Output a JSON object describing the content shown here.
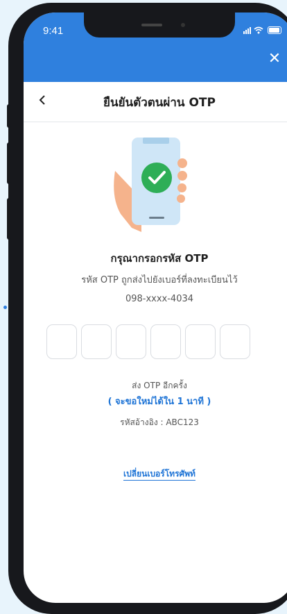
{
  "status_bar": {
    "time": "9:41"
  },
  "header": {
    "title": "ยืนยันตัวตนผ่าน OTP",
    "back_icon": "chevron-left-icon",
    "close_icon": "close-icon"
  },
  "main": {
    "prompt": "กรุณากรอกรหัส OTP",
    "description": "รหัส OTP ถูกส่งไปยังเบอร์ที่ลงทะเบียนไว้",
    "phone": "098-xxxx-4034",
    "otp_fields": [
      "",
      "",
      "",
      "",
      "",
      ""
    ],
    "resend_label": "ส่ง OTP อีกครั้ง",
    "countdown": "( จะขอใหม่ได้ใน 1 นาที )",
    "reference": "รหัสอ้างอิง : ABC123",
    "change_number": "เปลี่ยนเบอร์โทรศัพท์"
  },
  "colors": {
    "primary": "#2f80de",
    "link": "#1e74d6",
    "success": "#2eae57"
  }
}
